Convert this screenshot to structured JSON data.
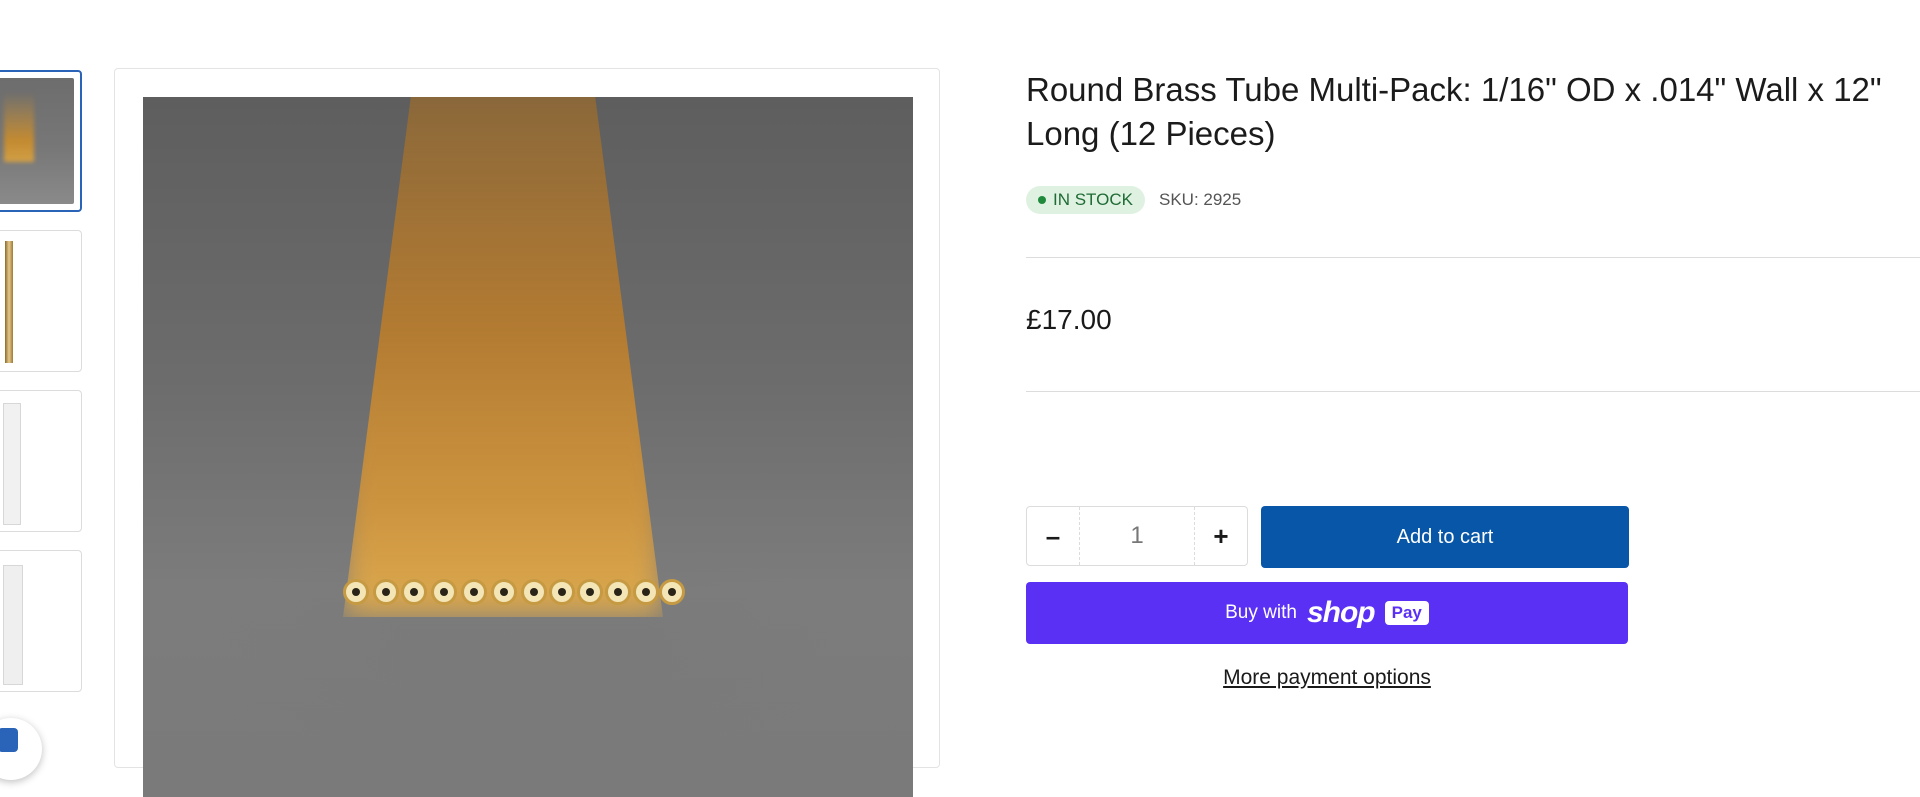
{
  "product": {
    "title": "Round Brass Tube Multi-Pack: 1/16\" OD x .014\" Wall x 12\" Long (12 Pieces)",
    "stock_label": "IN STOCK",
    "sku": "SKU: 2925",
    "price": "£17.00"
  },
  "purchase": {
    "quantity": "1",
    "decrement_label": "–",
    "increment_label": "+",
    "add_to_cart_label": "Add to cart",
    "buy_with_label": "Buy with",
    "shop_label": "shop",
    "pay_label": "Pay",
    "more_options_label": "More payment options"
  },
  "gallery": {
    "thumbnail_count": 4,
    "active_index": 0
  },
  "colors": {
    "add_to_cart": "#0856a8",
    "shop_pay": "#5a31f4",
    "stock_bg": "#dff2e2",
    "stock_text": "#1f6b35",
    "active_thumb_border": "#2a64b8"
  }
}
